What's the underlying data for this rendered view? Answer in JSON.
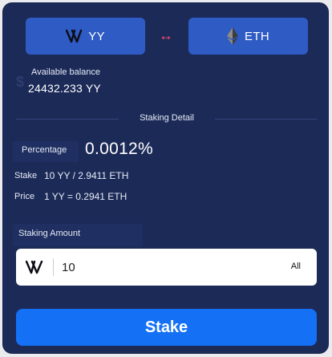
{
  "tokens": {
    "from": {
      "symbol": "YY",
      "icon": "yy-logo-icon"
    },
    "swap_icon": "swap-arrows-icon",
    "to": {
      "symbol": "ETH",
      "icon": "ethereum-icon"
    }
  },
  "balance": {
    "label": "Available balance",
    "value": "24432.233 YY",
    "icon": "dollar-icon"
  },
  "detail": {
    "title": "Staking Detail",
    "percentage_label": "Percentage",
    "percentage_value": "0.0012%",
    "stake_label": "Stake",
    "stake_value": "10 YY / 2.9411 ETH",
    "price_label": "Price",
    "price_value": "1 YY = 0.2941 ETH"
  },
  "amount": {
    "label": "Staking Amount",
    "value": "10",
    "all_label": "All"
  },
  "actions": {
    "stake_label": "Stake"
  },
  "colors": {
    "background": "#1c2a58",
    "token_button": "#2f5bc4",
    "swap_arrows": "#ff4d6a",
    "stake_button": "#1471f5"
  }
}
